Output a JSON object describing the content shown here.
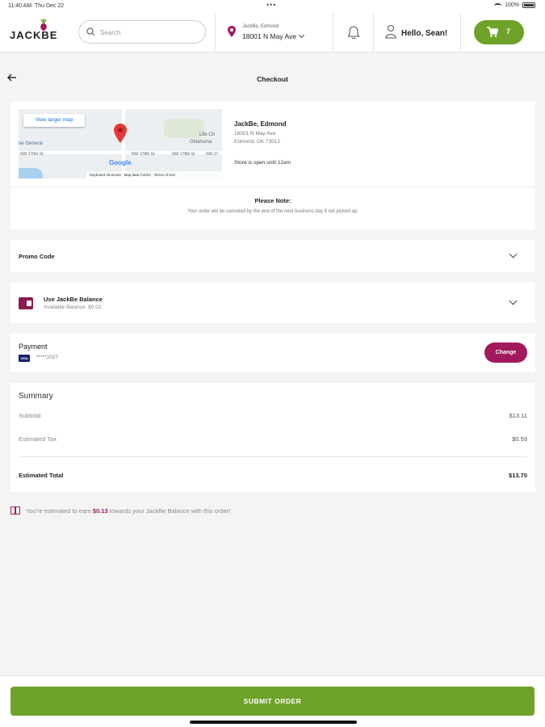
{
  "status_bar": {
    "time": "11:40 AM",
    "date": "Thu Dec 22",
    "dots": "•••",
    "battery": "100%"
  },
  "header": {
    "logo_text": "JACKBE",
    "search_placeholder": "Search",
    "store_name": "JackBe, Edmond",
    "store_address": "18001 N May Ave",
    "greeting": "Hello, Sean!",
    "cart_count": "7"
  },
  "page": {
    "title": "Checkout"
  },
  "store_card": {
    "map_button": "View larger map",
    "map_labels": [
      "Life Ch",
      "Oklahoma",
      "NW 178th St",
      "NW 178th St",
      "NW 178th St",
      "NW 17",
      "lar General"
    ],
    "google": "Google",
    "map_footer": [
      "Keyboard shortcuts",
      "Map data ©2022",
      "Terms of Use"
    ],
    "name": "JackBe, Edmond",
    "address_line1": "18001 N May Ave",
    "address_line2": "Edmond, OK 73012",
    "hours": "Store is open until 12am",
    "note_title": "Please Note:",
    "note_text": "Your order will be canceled by the end of the next business day if not picked up."
  },
  "promo": {
    "label": "Promo Code"
  },
  "balance": {
    "title": "Use JackBe Balance",
    "available": "Available Balance: $0.02"
  },
  "payment": {
    "title": "Payment",
    "card_brand": "VISA",
    "card_number": "*****2027",
    "change_label": "Change"
  },
  "summary": {
    "title": "Summary",
    "rows": [
      {
        "label": "Subtotal",
        "value": "$13.11"
      },
      {
        "label": "Estimated Tax",
        "value": "$0.59"
      }
    ],
    "total_label": "Estimated Total",
    "total_value": "$13.70"
  },
  "earn": {
    "prefix": "You're estimated to earn",
    "amount": "$0.13",
    "suffix": "towards your JackBe Balance with this order!"
  },
  "submit": {
    "label": "SUBMIT ORDER"
  },
  "colors": {
    "green": "#6ea228",
    "magenta": "#a3195b",
    "background": "#f4f4f2"
  }
}
